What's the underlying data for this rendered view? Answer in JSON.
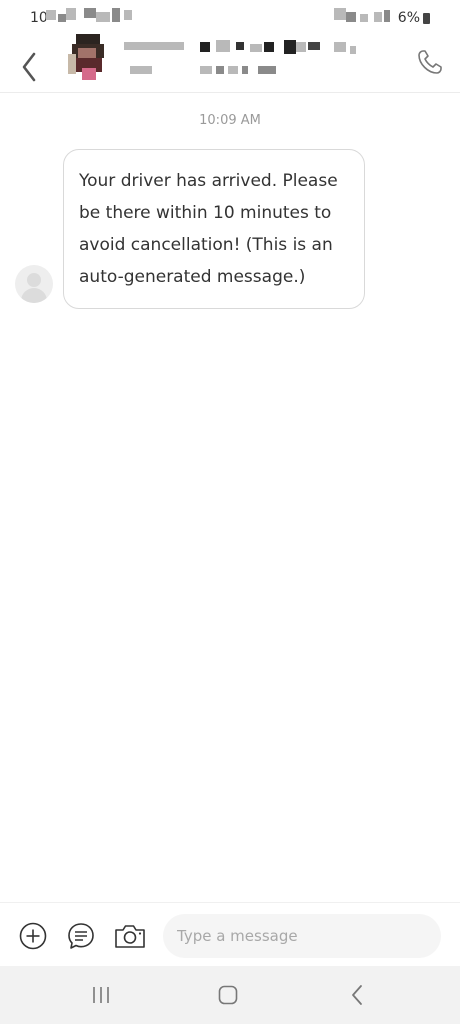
{
  "status_bar": {
    "time": "10",
    "battery": "6%"
  },
  "header": {
    "back_icon": "chevron-left-icon",
    "call_icon": "phone-icon"
  },
  "conversation": {
    "timestamp": "10:09 AM",
    "messages": [
      {
        "from": "driver",
        "text": "Your driver has arrived. Please be there within 10 minutes to avoid cancellation! (This is an auto-generated message.)"
      }
    ]
  },
  "composer": {
    "placeholder": "Type a message",
    "value": "",
    "icons": [
      "plus-circle-icon",
      "quick-reply-icon",
      "camera-icon"
    ]
  },
  "nav_bar": {
    "icons": [
      "recents-icon",
      "home-icon",
      "back-icon"
    ]
  },
  "colors": {
    "background": "#ffffff",
    "bubble_border": "#d9d9d9",
    "timestamp": "#9a9a9a",
    "input_background": "#f5f5f5",
    "nav_background": "#f2f2f2"
  }
}
